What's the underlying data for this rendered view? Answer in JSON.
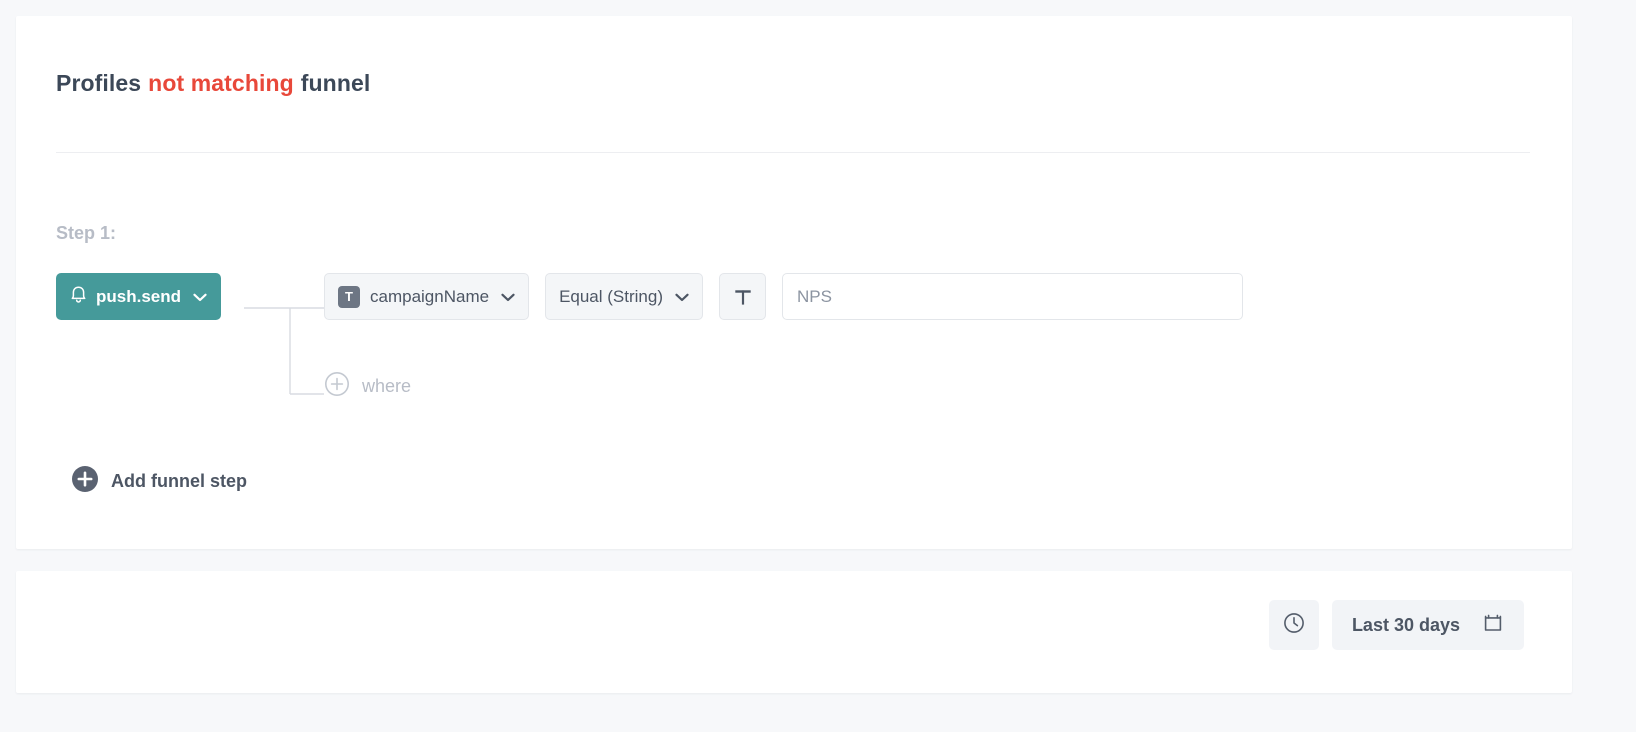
{
  "funnel_card": {
    "title": {
      "prefix": "Profiles",
      "negation": "not matching",
      "suffix": "funnel"
    },
    "step_label": "Step 1:",
    "event": {
      "name": "push.send",
      "icon": "bell-icon",
      "chevron": "chevron-down-icon",
      "color": "#459a9a"
    },
    "condition": {
      "property": {
        "type_badge": "T",
        "label": "campaignName",
        "chevron": "chevron-down-icon"
      },
      "operator": {
        "label": "Equal (String)",
        "chevron": "chevron-down-icon"
      },
      "type_toggle": {
        "icon": "text-type-icon",
        "glyph": "T"
      },
      "value": {
        "text": "NPS",
        "placeholder": "NPS"
      }
    },
    "where_row": {
      "icon": "circle-plus-outline-icon",
      "label": "where"
    },
    "add_step": {
      "icon": "circle-plus-filled-icon",
      "label": "Add funnel step"
    }
  },
  "bottom_bar": {
    "clock_button": {
      "icon": "clock-icon"
    },
    "date_range": {
      "label": "Last 30 days",
      "icon": "calendar-icon"
    }
  },
  "colors": {
    "accent_teal": "#459a9a",
    "negation_red": "#e8483a",
    "text_dark": "#3c4858",
    "text_muted": "#b7bcc6",
    "page_bg": "#f7f8fa"
  }
}
